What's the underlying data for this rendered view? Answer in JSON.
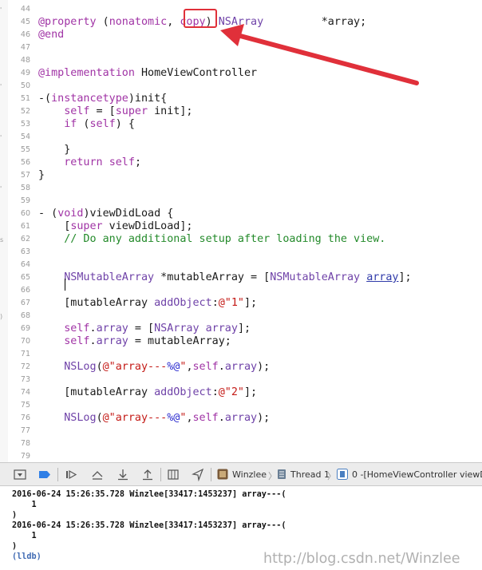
{
  "editor": {
    "gutter_marks": [
      "'",
      "",
      "",
      "'",
      "",
      "'",
      "",
      "'",
      "",
      "s",
      "",
      "",
      ")"
    ],
    "lines": [
      {
        "n": "44",
        "tokens": []
      },
      {
        "n": "45",
        "tokens": [
          {
            "t": "@property",
            "c": "kw"
          },
          {
            "t": " (",
            "c": ""
          },
          {
            "t": "nonatomic",
            "c": "kw"
          },
          {
            "t": ", ",
            "c": ""
          },
          {
            "t": "copy",
            "c": "kw"
          },
          {
            "t": ") ",
            "c": ""
          },
          {
            "t": "NSArray",
            "c": "cls"
          },
          {
            "t": "         *array;",
            "c": ""
          }
        ]
      },
      {
        "n": "46",
        "tokens": [
          {
            "t": "@end",
            "c": "kw"
          }
        ]
      },
      {
        "n": "47",
        "tokens": []
      },
      {
        "n": "48",
        "tokens": []
      },
      {
        "n": "49",
        "tokens": [
          {
            "t": "@implementation",
            "c": "kw"
          },
          {
            "t": " HomeViewController",
            "c": ""
          }
        ]
      },
      {
        "n": "50",
        "tokens": []
      },
      {
        "n": "51",
        "tokens": [
          {
            "t": "-(",
            "c": ""
          },
          {
            "t": "instancetype",
            "c": "kw"
          },
          {
            "t": ")init{",
            "c": ""
          }
        ]
      },
      {
        "n": "52",
        "tokens": [
          {
            "t": "    ",
            "c": ""
          },
          {
            "t": "self",
            "c": "kw"
          },
          {
            "t": " = [",
            "c": ""
          },
          {
            "t": "super",
            "c": "kw"
          },
          {
            "t": " init];",
            "c": ""
          }
        ]
      },
      {
        "n": "53",
        "tokens": [
          {
            "t": "    ",
            "c": ""
          },
          {
            "t": "if",
            "c": "kw"
          },
          {
            "t": " (",
            "c": ""
          },
          {
            "t": "self",
            "c": "kw"
          },
          {
            "t": ") {",
            "c": ""
          }
        ]
      },
      {
        "n": "54",
        "tokens": []
      },
      {
        "n": "55",
        "tokens": [
          {
            "t": "    }",
            "c": ""
          }
        ]
      },
      {
        "n": "56",
        "tokens": [
          {
            "t": "    ",
            "c": ""
          },
          {
            "t": "return",
            "c": "kw"
          },
          {
            "t": " ",
            "c": ""
          },
          {
            "t": "self",
            "c": "kw"
          },
          {
            "t": ";",
            "c": ""
          }
        ]
      },
      {
        "n": "57",
        "tokens": [
          {
            "t": "}",
            "c": ""
          }
        ]
      },
      {
        "n": "58",
        "tokens": []
      },
      {
        "n": "59",
        "tokens": []
      },
      {
        "n": "60",
        "tokens": [
          {
            "t": "- (",
            "c": ""
          },
          {
            "t": "void",
            "c": "kw"
          },
          {
            "t": ")viewDidLoad {",
            "c": ""
          }
        ]
      },
      {
        "n": "61",
        "tokens": [
          {
            "t": "    [",
            "c": ""
          },
          {
            "t": "super",
            "c": "kw"
          },
          {
            "t": " viewDidLoad];",
            "c": ""
          }
        ]
      },
      {
        "n": "62",
        "tokens": [
          {
            "t": "    // Do any additional setup after loading the view.",
            "c": "cm"
          }
        ]
      },
      {
        "n": "63",
        "tokens": []
      },
      {
        "n": "64",
        "tokens": []
      },
      {
        "n": "65",
        "tokens": [
          {
            "t": "    ",
            "c": ""
          },
          {
            "t": "NSMutableArray",
            "c": "cls"
          },
          {
            "t": " *mutableArray = [",
            "c": ""
          },
          {
            "t": "NSMutableArray",
            "c": "cls"
          },
          {
            "t": " ",
            "c": ""
          },
          {
            "t": "array",
            "c": "link"
          },
          {
            "t": "];",
            "c": ""
          }
        ]
      },
      {
        "n": "66",
        "tokens": []
      },
      {
        "n": "67",
        "tokens": [
          {
            "t": "    [mutableArray ",
            "c": ""
          },
          {
            "t": "addObject",
            "c": "cls"
          },
          {
            "t": ":",
            "c": ""
          },
          {
            "t": "@\"1\"",
            "c": "str"
          },
          {
            "t": "];",
            "c": ""
          }
        ]
      },
      {
        "n": "68",
        "tokens": []
      },
      {
        "n": "69",
        "tokens": [
          {
            "t": "    ",
            "c": ""
          },
          {
            "t": "self",
            "c": "kw"
          },
          {
            "t": ".",
            "c": ""
          },
          {
            "t": "array",
            "c": "cls"
          },
          {
            "t": " = [",
            "c": ""
          },
          {
            "t": "NSArray",
            "c": "cls"
          },
          {
            "t": " ",
            "c": ""
          },
          {
            "t": "array",
            "c": "cls"
          },
          {
            "t": "];",
            "c": ""
          }
        ]
      },
      {
        "n": "70",
        "tokens": [
          {
            "t": "    ",
            "c": ""
          },
          {
            "t": "self",
            "c": "kw"
          },
          {
            "t": ".",
            "c": ""
          },
          {
            "t": "array",
            "c": "cls"
          },
          {
            "t": " = mutableArray;",
            "c": ""
          }
        ]
      },
      {
        "n": "71",
        "tokens": []
      },
      {
        "n": "72",
        "tokens": [
          {
            "t": "    ",
            "c": ""
          },
          {
            "t": "NSLog",
            "c": "cls"
          },
          {
            "t": "(",
            "c": ""
          },
          {
            "t": "@\"array---",
            "c": "str"
          },
          {
            "t": "%@",
            "c": "fmt"
          },
          {
            "t": "\"",
            "c": "str"
          },
          {
            "t": ",",
            "c": ""
          },
          {
            "t": "self",
            "c": "kw"
          },
          {
            "t": ".",
            "c": ""
          },
          {
            "t": "array",
            "c": "cls"
          },
          {
            "t": ");",
            "c": ""
          }
        ]
      },
      {
        "n": "73",
        "tokens": []
      },
      {
        "n": "74",
        "tokens": [
          {
            "t": "    [mutableArray ",
            "c": ""
          },
          {
            "t": "addObject",
            "c": "cls"
          },
          {
            "t": ":",
            "c": ""
          },
          {
            "t": "@\"2\"",
            "c": "str"
          },
          {
            "t": "];",
            "c": ""
          }
        ]
      },
      {
        "n": "75",
        "tokens": []
      },
      {
        "n": "76",
        "tokens": [
          {
            "t": "    ",
            "c": ""
          },
          {
            "t": "NSLog",
            "c": "cls"
          },
          {
            "t": "(",
            "c": ""
          },
          {
            "t": "@\"array---",
            "c": "str"
          },
          {
            "t": "%@",
            "c": "fmt"
          },
          {
            "t": "\"",
            "c": "str"
          },
          {
            "t": ",",
            "c": ""
          },
          {
            "t": "self",
            "c": "kw"
          },
          {
            "t": ".",
            "c": ""
          },
          {
            "t": "array",
            "c": "cls"
          },
          {
            "t": ");",
            "c": ""
          }
        ]
      },
      {
        "n": "77",
        "tokens": []
      },
      {
        "n": "78",
        "tokens": []
      },
      {
        "n": "79",
        "tokens": []
      }
    ]
  },
  "debug_bar": {
    "icons": [
      "hide-console-icon",
      "breakpoints-toggle-icon",
      "continue-icon",
      "step-over-icon",
      "step-into-icon",
      "step-out-icon",
      "view-debugger-icon",
      "location-icon"
    ],
    "breadcrumbs": [
      "Winzlee",
      "Thread 1",
      "0 -[HomeViewController viewDi"
    ]
  },
  "console": {
    "lines": [
      "2016-06-24 15:26:35.728 Winzlee[33417:1453237] array---(",
      "    1",
      ")",
      "2016-06-24 15:26:35.728 Winzlee[33417:1453237] array---(",
      "    1",
      ")"
    ],
    "prompt": "(lldb)"
  },
  "watermark": "http://blog.csdn.net/Winzlee",
  "colors": {
    "annotation": "#e0303a",
    "keyword": "#a033a5",
    "class": "#6f42a8",
    "comment": "#238a2a",
    "string": "#c41a16"
  }
}
